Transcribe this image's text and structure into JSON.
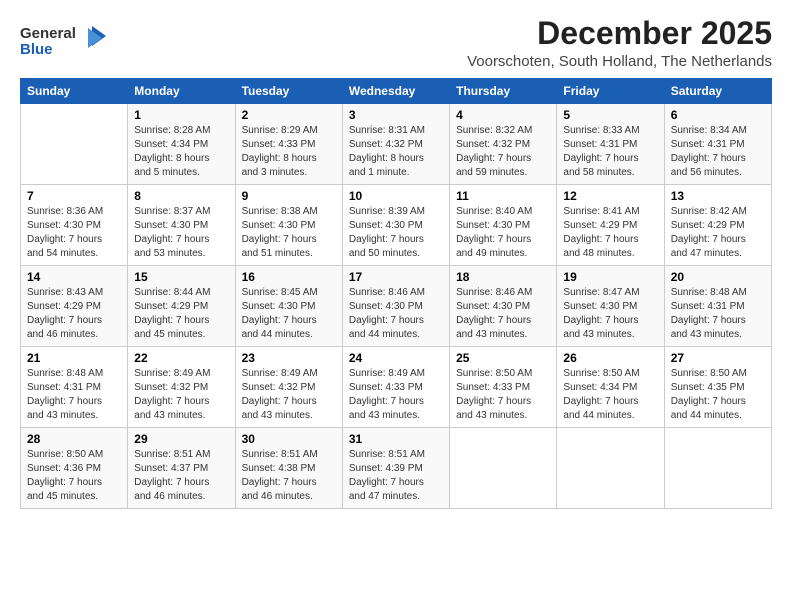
{
  "logo": {
    "general": "General",
    "blue": "Blue"
  },
  "title": "December 2025",
  "subtitle": "Voorschoten, South Holland, The Netherlands",
  "days_of_week": [
    "Sunday",
    "Monday",
    "Tuesday",
    "Wednesday",
    "Thursday",
    "Friday",
    "Saturday"
  ],
  "weeks": [
    [
      {
        "day": "",
        "info": ""
      },
      {
        "day": "1",
        "info": "Sunrise: 8:28 AM\nSunset: 4:34 PM\nDaylight: 8 hours\nand 5 minutes."
      },
      {
        "day": "2",
        "info": "Sunrise: 8:29 AM\nSunset: 4:33 PM\nDaylight: 8 hours\nand 3 minutes."
      },
      {
        "day": "3",
        "info": "Sunrise: 8:31 AM\nSunset: 4:32 PM\nDaylight: 8 hours\nand 1 minute."
      },
      {
        "day": "4",
        "info": "Sunrise: 8:32 AM\nSunset: 4:32 PM\nDaylight: 7 hours\nand 59 minutes."
      },
      {
        "day": "5",
        "info": "Sunrise: 8:33 AM\nSunset: 4:31 PM\nDaylight: 7 hours\nand 58 minutes."
      },
      {
        "day": "6",
        "info": "Sunrise: 8:34 AM\nSunset: 4:31 PM\nDaylight: 7 hours\nand 56 minutes."
      }
    ],
    [
      {
        "day": "7",
        "info": "Sunrise: 8:36 AM\nSunset: 4:30 PM\nDaylight: 7 hours\nand 54 minutes."
      },
      {
        "day": "8",
        "info": "Sunrise: 8:37 AM\nSunset: 4:30 PM\nDaylight: 7 hours\nand 53 minutes."
      },
      {
        "day": "9",
        "info": "Sunrise: 8:38 AM\nSunset: 4:30 PM\nDaylight: 7 hours\nand 51 minutes."
      },
      {
        "day": "10",
        "info": "Sunrise: 8:39 AM\nSunset: 4:30 PM\nDaylight: 7 hours\nand 50 minutes."
      },
      {
        "day": "11",
        "info": "Sunrise: 8:40 AM\nSunset: 4:30 PM\nDaylight: 7 hours\nand 49 minutes."
      },
      {
        "day": "12",
        "info": "Sunrise: 8:41 AM\nSunset: 4:29 PM\nDaylight: 7 hours\nand 48 minutes."
      },
      {
        "day": "13",
        "info": "Sunrise: 8:42 AM\nSunset: 4:29 PM\nDaylight: 7 hours\nand 47 minutes."
      }
    ],
    [
      {
        "day": "14",
        "info": "Sunrise: 8:43 AM\nSunset: 4:29 PM\nDaylight: 7 hours\nand 46 minutes."
      },
      {
        "day": "15",
        "info": "Sunrise: 8:44 AM\nSunset: 4:29 PM\nDaylight: 7 hours\nand 45 minutes."
      },
      {
        "day": "16",
        "info": "Sunrise: 8:45 AM\nSunset: 4:30 PM\nDaylight: 7 hours\nand 44 minutes."
      },
      {
        "day": "17",
        "info": "Sunrise: 8:46 AM\nSunset: 4:30 PM\nDaylight: 7 hours\nand 44 minutes."
      },
      {
        "day": "18",
        "info": "Sunrise: 8:46 AM\nSunset: 4:30 PM\nDaylight: 7 hours\nand 43 minutes."
      },
      {
        "day": "19",
        "info": "Sunrise: 8:47 AM\nSunset: 4:30 PM\nDaylight: 7 hours\nand 43 minutes."
      },
      {
        "day": "20",
        "info": "Sunrise: 8:48 AM\nSunset: 4:31 PM\nDaylight: 7 hours\nand 43 minutes."
      }
    ],
    [
      {
        "day": "21",
        "info": "Sunrise: 8:48 AM\nSunset: 4:31 PM\nDaylight: 7 hours\nand 43 minutes."
      },
      {
        "day": "22",
        "info": "Sunrise: 8:49 AM\nSunset: 4:32 PM\nDaylight: 7 hours\nand 43 minutes."
      },
      {
        "day": "23",
        "info": "Sunrise: 8:49 AM\nSunset: 4:32 PM\nDaylight: 7 hours\nand 43 minutes."
      },
      {
        "day": "24",
        "info": "Sunrise: 8:49 AM\nSunset: 4:33 PM\nDaylight: 7 hours\nand 43 minutes."
      },
      {
        "day": "25",
        "info": "Sunrise: 8:50 AM\nSunset: 4:33 PM\nDaylight: 7 hours\nand 43 minutes."
      },
      {
        "day": "26",
        "info": "Sunrise: 8:50 AM\nSunset: 4:34 PM\nDaylight: 7 hours\nand 44 minutes."
      },
      {
        "day": "27",
        "info": "Sunrise: 8:50 AM\nSunset: 4:35 PM\nDaylight: 7 hours\nand 44 minutes."
      }
    ],
    [
      {
        "day": "28",
        "info": "Sunrise: 8:50 AM\nSunset: 4:36 PM\nDaylight: 7 hours\nand 45 minutes."
      },
      {
        "day": "29",
        "info": "Sunrise: 8:51 AM\nSunset: 4:37 PM\nDaylight: 7 hours\nand 46 minutes."
      },
      {
        "day": "30",
        "info": "Sunrise: 8:51 AM\nSunset: 4:38 PM\nDaylight: 7 hours\nand 46 minutes."
      },
      {
        "day": "31",
        "info": "Sunrise: 8:51 AM\nSunset: 4:39 PM\nDaylight: 7 hours\nand 47 minutes."
      },
      {
        "day": "",
        "info": ""
      },
      {
        "day": "",
        "info": ""
      },
      {
        "day": "",
        "info": ""
      }
    ]
  ]
}
